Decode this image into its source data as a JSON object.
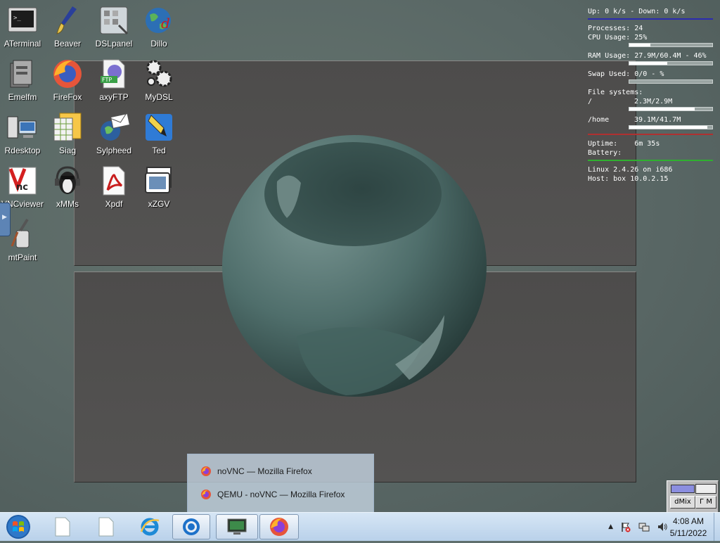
{
  "desktop": {
    "icons": [
      {
        "label": "ATerminal",
        "icon": "terminal-icon"
      },
      {
        "label": "Beaver",
        "icon": "paintbrush-icon"
      },
      {
        "label": "DSLpanel",
        "icon": "control-panel-icon"
      },
      {
        "label": "Dillo",
        "icon": "globe-icon"
      },
      {
        "label": "Emelfm",
        "icon": "file-manager-icon"
      },
      {
        "label": "FireFox",
        "icon": "firefox-icon"
      },
      {
        "label": "axyFTP",
        "icon": "ftp-icon"
      },
      {
        "label": "MyDSL",
        "icon": "gears-icon"
      },
      {
        "label": "Rdesktop",
        "icon": "remote-desktop-icon"
      },
      {
        "label": "Siag",
        "icon": "spreadsheet-icon"
      },
      {
        "label": "Sylpheed",
        "icon": "mail-icon"
      },
      {
        "label": "Ted",
        "icon": "pen-icon"
      },
      {
        "label": "VNCviewer",
        "icon": "vnc-icon"
      },
      {
        "label": "xMMs",
        "icon": "penguin-headphones-icon"
      },
      {
        "label": "Xpdf",
        "icon": "pdf-icon"
      },
      {
        "label": "xZGV",
        "icon": "image-viewer-icon"
      },
      {
        "label": "mtPaint",
        "icon": "paint-tools-icon"
      }
    ]
  },
  "sysmon": {
    "net": "Up: 0 k/s - Down: 0 k/s",
    "processes": "Processes: 24",
    "cpu": "CPU Usage: 25%",
    "cpu_fraction": 0.25,
    "ram": "RAM Usage: 27.9M/60.4M - 46%",
    "ram_fraction": 0.46,
    "swap": "Swap Used: 0/0 - %",
    "swap_fraction": 0,
    "fs_header": "File systems:",
    "fs_root_name": "/",
    "fs_root_value": "2.3M/2.9M",
    "fs_root_fraction": 0.79,
    "fs_home_name": "/home",
    "fs_home_value": "39.1M/41.7M",
    "fs_home_fraction": 0.94,
    "uptime": "Uptime:    6m 35s",
    "battery": "Battery:",
    "kernel": "Linux 2.4.26 on i686",
    "host": "Host: box 10.0.2.15",
    "colors": {
      "net_rule": "#2b2bb0",
      "uptime_rule": "#b03030",
      "kernel_rule": "#2fb02f"
    }
  },
  "dmix": {
    "label": "dMix",
    "button2": "Г M"
  },
  "popup": {
    "items": [
      {
        "label": "noVNC — Mozilla Firefox"
      },
      {
        "label": "QEMU - noVNC — Mozilla Firefox"
      }
    ]
  },
  "taskbar": {
    "clock_time": "4:08 AM",
    "clock_date": "5/11/2022"
  }
}
